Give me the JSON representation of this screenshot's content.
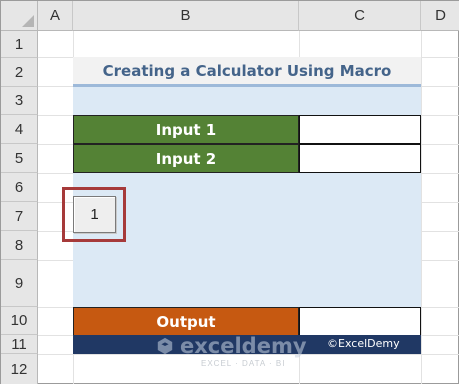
{
  "columns": [
    "A",
    "B",
    "C",
    "D"
  ],
  "rows": [
    "1",
    "2",
    "3",
    "4",
    "5",
    "6",
    "7",
    "8",
    "9",
    "10",
    "11",
    "12"
  ],
  "title": "Creating a Calculator Using Macro",
  "input1": {
    "label": "Input 1",
    "value": ""
  },
  "input2": {
    "label": "Input 2",
    "value": ""
  },
  "output": {
    "label": "Output",
    "value": ""
  },
  "macro_button": {
    "label": "1"
  },
  "footer": {
    "copyright": "©ExcelDemy",
    "watermark_name": "exceldemy",
    "watermark_tagline": "EXCEL · DATA · BI"
  },
  "colors": {
    "label_green": "#548235",
    "label_orange": "#c65911",
    "area_blue": "#dce9f5",
    "footer_navy": "#203864",
    "button_highlight": "#a63a3a"
  }
}
